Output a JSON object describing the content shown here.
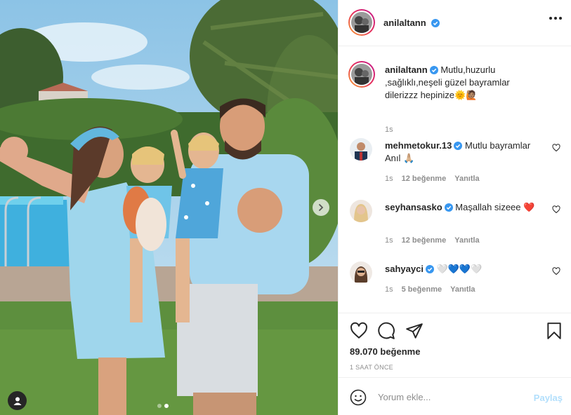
{
  "post": {
    "username": "anilaltann",
    "verified": true
  },
  "caption": {
    "username": "anilaltann",
    "text": "Mutlu,huzurlu ,sağlıklı,neşeli güzel bayramlar dilerizzz hepinize",
    "emoji": "🌞🙋🏽",
    "time": "1s"
  },
  "comments": [
    {
      "username": "mehmetokur.13",
      "verified": true,
      "text": "Mutlu bayramlar Anıl",
      "emoji": "🙏🏼",
      "time": "1s",
      "likes": "12 beğenme",
      "reply": "Yanıtla"
    },
    {
      "username": "seyhansasko",
      "verified": true,
      "text": "Maşallah sizeee",
      "emoji": "❤️",
      "time": "1s",
      "likes": "12 beğenme",
      "reply": "Yanıtla"
    },
    {
      "username": "sahyayci",
      "verified": true,
      "text": "",
      "emoji": "🤍💙💙🤍",
      "time": "1s",
      "likes": "5 beğenme",
      "reply": "Yanıtla"
    }
  ],
  "stats": {
    "likes": "89.070 beğenme",
    "posted": "1 SAAT ÖNCE"
  },
  "add_comment": {
    "placeholder": "Yorum ekle...",
    "post_label": "Paylaş"
  },
  "carousel": {
    "slides": 2,
    "active_index": 1
  },
  "icons": [
    "verified-badge-icon",
    "more-options-icon",
    "heart-icon",
    "comment-icon",
    "share-icon",
    "bookmark-icon",
    "emoji-icon",
    "chevron-right-icon",
    "user-tag-icon"
  ],
  "colors": {
    "verified": "#3897f0",
    "link_disabled": "#b2dffc",
    "muted": "#8e8e8e",
    "text": "#262626",
    "border": "#efefef"
  }
}
